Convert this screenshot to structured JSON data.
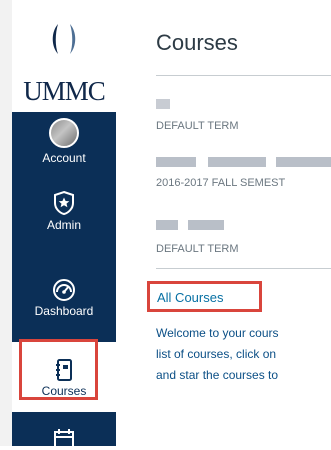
{
  "logo": {
    "text": "UMMC"
  },
  "nav": {
    "items": [
      {
        "id": "account",
        "label": "Account"
      },
      {
        "id": "admin",
        "label": "Admin"
      },
      {
        "id": "dashboard",
        "label": "Dashboard"
      },
      {
        "id": "courses",
        "label": "Courses"
      }
    ]
  },
  "main": {
    "title": "Courses",
    "courses": [
      {
        "term": "DEFAULT TERM"
      },
      {
        "term": "2016-2017 FALL SEMEST"
      },
      {
        "term": "DEFAULT TERM"
      }
    ],
    "all_courses_link": "All Courses",
    "welcome_lines": [
      "Welcome to your cours",
      "list of courses, click on",
      "and star the courses to"
    ]
  },
  "colors": {
    "nav_bg": "#0b2f57",
    "highlight": "#d9453c",
    "link": "#0770a3"
  }
}
